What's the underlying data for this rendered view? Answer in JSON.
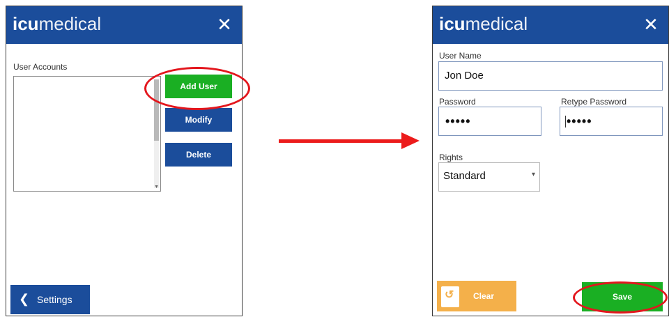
{
  "colors": {
    "titlebar": "#1b4d9b",
    "primary_button": "#1b4d9b",
    "add_button": "#1aaf23",
    "save_button": "#1aaf23",
    "clear_button": "#f4b04a",
    "annotation": "#e3161d"
  },
  "left_panel": {
    "logo_bold": "icu",
    "logo_thin": "medical",
    "close_icon": "close-icon",
    "user_accounts_label": "User Accounts",
    "buttons": {
      "add_user": "Add User",
      "modify": "Modify",
      "delete": "Delete"
    },
    "settings_button": "Settings",
    "settings_icon": "chevron-left-icon"
  },
  "right_panel": {
    "logo_bold": "icu",
    "logo_thin": "medical",
    "close_icon": "close-icon",
    "user_name_label": "User Name",
    "user_name_value": "Jon Doe",
    "password_label": "Password",
    "password_value": "•••••",
    "retype_password_label": "Retype Password",
    "retype_password_value": "•••••",
    "rights_label": "Rights",
    "rights_value": "Standard",
    "clear_button": "Clear",
    "clear_icon": "refresh-icon",
    "save_button": "Save"
  }
}
